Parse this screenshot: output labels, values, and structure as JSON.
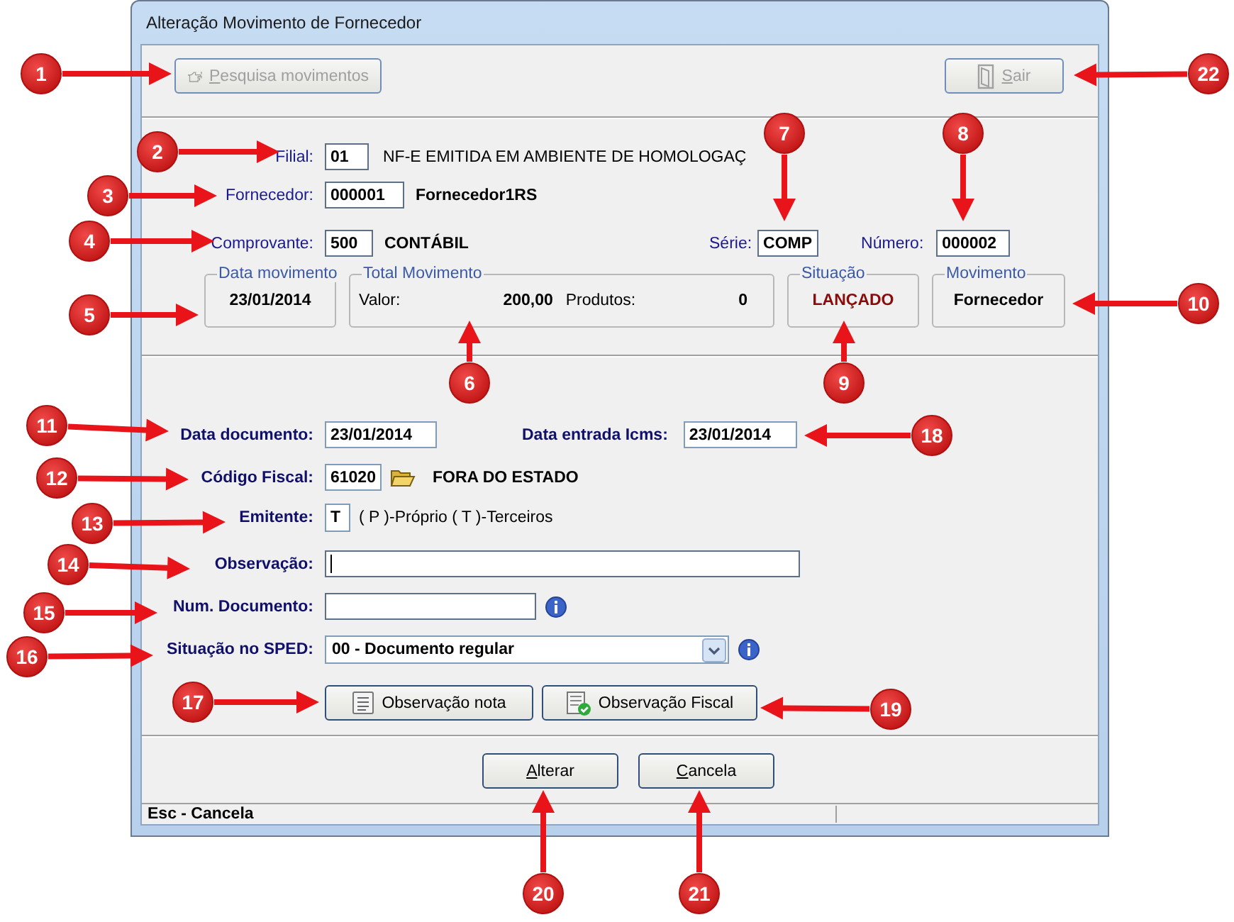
{
  "window": {
    "title": "Alteração Movimento de Fornecedor"
  },
  "toolbar": [
    {
      "label": "Pesquisa movimentos",
      "kind": "search",
      "disabled": true
    },
    {
      "label": "Sair",
      "kind": "exit",
      "disabled": true
    }
  ],
  "header": {
    "filial": {
      "label": "Filial:",
      "value": "01",
      "description": "NF-E EMITIDA EM AMBIENTE DE HOMOLOGAÇ"
    },
    "fornecedor": {
      "label": "Fornecedor:",
      "value": "000001",
      "name": "Fornecedor1RS"
    },
    "comprovante": {
      "label": "Comprovante:",
      "value": "500",
      "name": "CONTÁBIL"
    },
    "serie": {
      "label": "Série:",
      "value": "COMP"
    },
    "numero": {
      "label": "Número:",
      "value": "000002"
    }
  },
  "groups": [
    {
      "title": "Data movimento",
      "kind": "value",
      "value": "23/01/2014"
    },
    {
      "title": "Total Movimento",
      "kind": "totals",
      "valor_label": "Valor:",
      "valor": "200,00",
      "produtos_label": "Produtos:",
      "produtos": "0"
    },
    {
      "title": "Situação",
      "kind": "status",
      "value": "LANÇADO"
    },
    {
      "title": "Movimento",
      "kind": "value",
      "value": "Fornecedor"
    }
  ],
  "form": {
    "data_documento": {
      "label": "Data documento:",
      "value": "23/01/2014"
    },
    "data_entrada_icms": {
      "label": "Data entrada Icms:",
      "value": "23/01/2014"
    },
    "codigo_fiscal": {
      "label": "Código Fiscal:",
      "value": "61020",
      "description": "FORA DO ESTADO"
    },
    "emitente": {
      "label": "Emitente:",
      "value": "T",
      "hint": "( P )-Próprio ( T )-Terceiros"
    },
    "observacao": {
      "label": "Observação:",
      "focused": true
    },
    "num_documento": {
      "label": "Num. Documento:"
    },
    "situacao_sped": {
      "label": "Situação no SPED:",
      "value": "00 - Documento regular"
    }
  },
  "note_buttons": [
    {
      "label": "Observação nota",
      "kind": "note"
    },
    {
      "label": "Observação Fiscal",
      "kind": "fiscal"
    }
  ],
  "actions": [
    {
      "label": "Alterar",
      "disabled": false
    },
    {
      "label": "Cancela",
      "disabled": false
    }
  ],
  "status_bar": {
    "text": "Esc - Cancela"
  },
  "callouts": [
    {
      "number": "1"
    },
    {
      "number": "2"
    },
    {
      "number": "3"
    },
    {
      "number": "4"
    },
    {
      "number": "5"
    },
    {
      "number": "6"
    },
    {
      "number": "7"
    },
    {
      "number": "8"
    },
    {
      "number": "9"
    },
    {
      "number": "10"
    },
    {
      "number": "11"
    },
    {
      "number": "12"
    },
    {
      "number": "13"
    },
    {
      "number": "14"
    },
    {
      "number": "15"
    },
    {
      "number": "16"
    },
    {
      "number": "17"
    },
    {
      "number": "18"
    },
    {
      "number": "19"
    },
    {
      "number": "20"
    },
    {
      "number": "21"
    },
    {
      "number": "22"
    }
  ]
}
